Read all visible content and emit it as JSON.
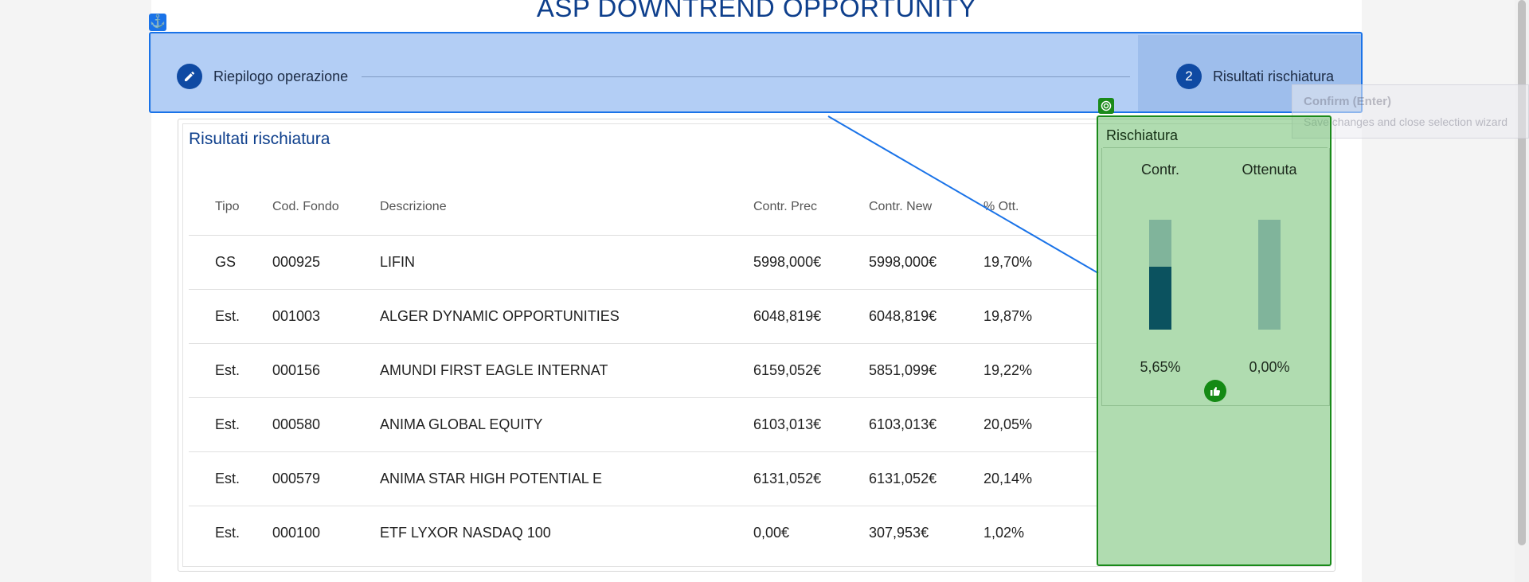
{
  "page_title": "ASP DOWNTREND OPPORTUNITY",
  "stepper": {
    "steps": [
      {
        "label": "Riepilogo operazione",
        "icon": "pencil-icon"
      },
      {
        "label": "Risultati rischiatura",
        "number": "2"
      }
    ]
  },
  "results": {
    "title": "Risultati rischiatura",
    "columns": [
      "Tipo",
      "Cod. Fondo",
      "Descrizione",
      "Contr. Prec",
      "Contr. New",
      "% Ott."
    ],
    "rows": [
      [
        "GS",
        "000925",
        "LIFIN",
        "5998,000€",
        "5998,000€",
        "19,70%"
      ],
      [
        "Est.",
        "001003",
        "ALGER DYNAMIC OPPORTUNITIES",
        "6048,819€",
        "6048,819€",
        "19,87%"
      ],
      [
        "Est.",
        "000156",
        "AMUNDI FIRST EAGLE INTERNAT",
        "6159,052€",
        "5851,099€",
        "19,22%"
      ],
      [
        "Est.",
        "000580",
        "ANIMA GLOBAL EQUITY",
        "6103,013€",
        "6103,013€",
        "20,05%"
      ],
      [
        "Est.",
        "000579",
        "ANIMA STAR HIGH POTENTIAL E",
        "6131,052€",
        "6131,052€",
        "20,14%"
      ],
      [
        "Est.",
        "000100",
        "ETF LYXOR NASDAQ 100",
        "0,00€",
        "307,953€",
        "1,02%"
      ]
    ]
  },
  "rischiatura": {
    "title": "Rischiatura",
    "contr_label": "Contr.",
    "ottenuta_label": "Ottenuta",
    "contr_value": "5,65%",
    "ottenuta_value": "0,00%",
    "contr_fill_fraction": 0.57,
    "ottenuta_fill_fraction": 0.0,
    "status_icon": "thumbs-up-icon"
  },
  "confirm_tooltip": {
    "title": "Confirm (Enter)",
    "subtitle": "Save changes and close selection wizard"
  },
  "colors": {
    "primary": "#0e3f8c",
    "stepper_overlay": "#4285e6",
    "risk_overlay": "#62ba62",
    "bar_track": "#80b49b",
    "bar_fill": "#0b525f"
  }
}
